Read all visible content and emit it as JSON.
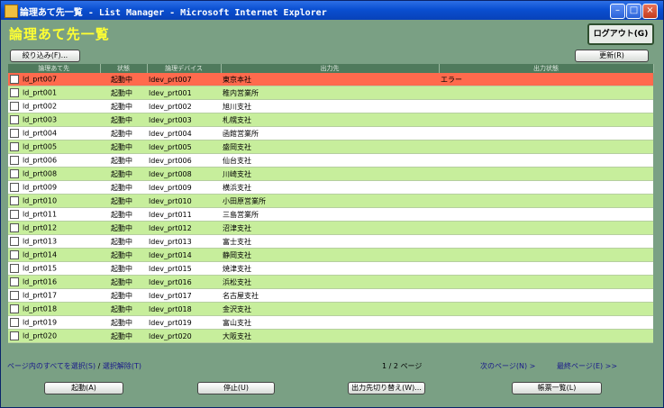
{
  "window": {
    "title": "論理あて先一覧 - List Manager - Microsoft Internet Explorer"
  },
  "header": {
    "title": "論理あて先一覧",
    "logout_label": "ログアウト(G)"
  },
  "toolbar": {
    "filter_label": "絞り込み(F)...",
    "refresh_label": "更新(R)"
  },
  "table": {
    "columns": [
      "論理あて先",
      "状態",
      "論理デバイス",
      "出力先",
      "出力状態"
    ],
    "rows": [
      {
        "name": "ld_prt007",
        "state": "起動中",
        "device": "ldev_prt007",
        "dest": "東京本社",
        "out_state": "エラー",
        "error": true
      },
      {
        "name": "ld_prt001",
        "state": "起動中",
        "device": "ldev_prt001",
        "dest": "稚内営業所",
        "out_state": ""
      },
      {
        "name": "ld_prt002",
        "state": "起動中",
        "device": "ldev_prt002",
        "dest": "旭川支社",
        "out_state": ""
      },
      {
        "name": "ld_prt003",
        "state": "起動中",
        "device": "ldev_prt003",
        "dest": "札幌支社",
        "out_state": ""
      },
      {
        "name": "ld_prt004",
        "state": "起動中",
        "device": "ldev_prt004",
        "dest": "函館営業所",
        "out_state": ""
      },
      {
        "name": "ld_prt005",
        "state": "起動中",
        "device": "ldev_prt005",
        "dest": "盛岡支社",
        "out_state": ""
      },
      {
        "name": "ld_prt006",
        "state": "起動中",
        "device": "ldev_prt006",
        "dest": "仙台支社",
        "out_state": ""
      },
      {
        "name": "ld_prt008",
        "state": "起動中",
        "device": "ldev_prt008",
        "dest": "川崎支社",
        "out_state": ""
      },
      {
        "name": "ld_prt009",
        "state": "起動中",
        "device": "ldev_prt009",
        "dest": "横浜支社",
        "out_state": ""
      },
      {
        "name": "ld_prt010",
        "state": "起動中",
        "device": "ldev_prt010",
        "dest": "小田原営業所",
        "out_state": ""
      },
      {
        "name": "ld_prt011",
        "state": "起動中",
        "device": "ldev_prt011",
        "dest": "三島営業所",
        "out_state": ""
      },
      {
        "name": "ld_prt012",
        "state": "起動中",
        "device": "ldev_prt012",
        "dest": "沼津支社",
        "out_state": ""
      },
      {
        "name": "ld_prt013",
        "state": "起動中",
        "device": "ldev_prt013",
        "dest": "富士支社",
        "out_state": ""
      },
      {
        "name": "ld_prt014",
        "state": "起動中",
        "device": "ldev_prt014",
        "dest": "静岡支社",
        "out_state": ""
      },
      {
        "name": "ld_prt015",
        "state": "起動中",
        "device": "ldev_prt015",
        "dest": "焼津支社",
        "out_state": ""
      },
      {
        "name": "ld_prt016",
        "state": "起動中",
        "device": "ldev_prt016",
        "dest": "浜松支社",
        "out_state": ""
      },
      {
        "name": "ld_prt017",
        "state": "起動中",
        "device": "ldev_prt017",
        "dest": "名古屋支社",
        "out_state": ""
      },
      {
        "name": "ld_prt018",
        "state": "起動中",
        "device": "ldev_prt018",
        "dest": "金沢支社",
        "out_state": ""
      },
      {
        "name": "ld_prt019",
        "state": "起動中",
        "device": "ldev_prt019",
        "dest": "富山支社",
        "out_state": ""
      },
      {
        "name": "ld_prt020",
        "state": "起動中",
        "device": "ldev_prt020",
        "dest": "大阪支社",
        "out_state": ""
      }
    ]
  },
  "footer": {
    "select_all": "ページ内のすべてを選択(S)",
    "separator": "/",
    "deselect": "選択解除(T)",
    "page_info": "1 / 2 ページ",
    "next_page": "次のページ(N) >",
    "last_page": "最終ページ(E) >>"
  },
  "actions": {
    "start": "起動(A)",
    "stop": "停止(U)",
    "switch_dest": "出力先切り替え(W)...",
    "forms": "帳票一覧(L)"
  },
  "colors": {
    "row_green": "#c7ee9c",
    "row_error": "#ff6a4d",
    "bg": "#7aa084",
    "title_yellow": "#ffff33"
  }
}
